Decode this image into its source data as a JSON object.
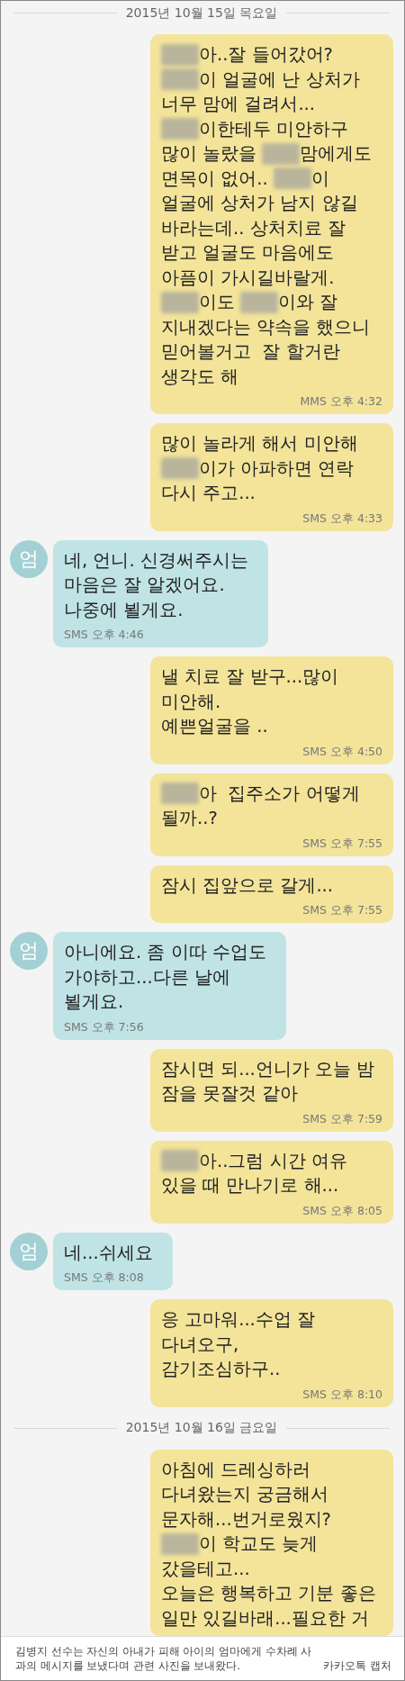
{
  "conversation": [
    {
      "kind": "date",
      "text": "2015년 10월 15일 목요일"
    },
    {
      "kind": "sent",
      "meta": "MMS 오후 4:32",
      "lines": [
        [
          {
            "kind": "redacted"
          },
          {
            "kind": "text",
            "text": "아..잘 들어갔어?"
          }
        ],
        [
          {
            "kind": "redacted"
          },
          {
            "kind": "text",
            "text": "이 얼굴에 난 상처가"
          }
        ],
        [
          {
            "kind": "text",
            "text": "너무 맘에 걸려서..."
          }
        ],
        [
          {
            "kind": "redacted"
          },
          {
            "kind": "text",
            "text": "이한테두 미안하구"
          }
        ],
        [
          {
            "kind": "text",
            "text": "많이 놀랐을 "
          },
          {
            "kind": "redacted"
          },
          {
            "kind": "text",
            "text": "맘에게도"
          }
        ],
        [
          {
            "kind": "text",
            "text": "면목이 없어.. "
          },
          {
            "kind": "redacted"
          },
          {
            "kind": "text",
            "text": "이"
          }
        ],
        [
          {
            "kind": "text",
            "text": "얼굴에 상처가 남지 않길"
          }
        ],
        [
          {
            "kind": "text",
            "text": "바라는데.. 상처치료 잘"
          }
        ],
        [
          {
            "kind": "text",
            "text": "받고 얼굴도 마음에도"
          }
        ],
        [
          {
            "kind": "text",
            "text": "아픔이 가시길바랄게."
          }
        ],
        [
          {
            "kind": "redacted"
          },
          {
            "kind": "text",
            "text": "이도 "
          },
          {
            "kind": "redacted"
          },
          {
            "kind": "text",
            "text": "이와 잘"
          }
        ],
        [
          {
            "kind": "text",
            "text": "지내겠다는 약속을 했으니"
          }
        ],
        [
          {
            "kind": "text",
            "text": "믿어볼거고  잘 할거란"
          }
        ],
        [
          {
            "kind": "text",
            "text": "생각도 해"
          }
        ]
      ]
    },
    {
      "kind": "sent",
      "meta": "SMS 오후 4:33",
      "lines": [
        [
          {
            "kind": "text",
            "text": "많이 놀라게 해서 미안해"
          }
        ],
        [
          {
            "kind": "redacted"
          },
          {
            "kind": "text",
            "text": "이가 아파하면 연락"
          }
        ],
        [
          {
            "kind": "text",
            "text": "다시 주고..."
          }
        ]
      ]
    },
    {
      "kind": "received",
      "avatar": "엄",
      "meta": "SMS 오후 4:46",
      "lines": [
        [
          {
            "kind": "text",
            "text": "네, 언니. 신경써주시는"
          }
        ],
        [
          {
            "kind": "text",
            "text": "마음은 잘 알겠어요."
          }
        ],
        [
          {
            "kind": "text",
            "text": "나중에 뵐게요."
          }
        ]
      ]
    },
    {
      "kind": "sent",
      "meta": "SMS 오후 4:50",
      "lines": [
        [
          {
            "kind": "text",
            "text": "낼 치료 잘 받구...많이"
          }
        ],
        [
          {
            "kind": "text",
            "text": "미안해."
          }
        ],
        [
          {
            "kind": "text",
            "text": "예쁜얼굴을 .."
          }
        ]
      ]
    },
    {
      "kind": "sent",
      "meta": "SMS 오후 7:55",
      "lines": [
        [
          {
            "kind": "redacted"
          },
          {
            "kind": "text",
            "text": "아  집주소가 어떻게"
          }
        ],
        [
          {
            "kind": "text",
            "text": "될까..?"
          }
        ]
      ]
    },
    {
      "kind": "sent",
      "meta": "SMS 오후 7:55",
      "lines": [
        [
          {
            "kind": "text",
            "text": "잠시 집앞으로 갈게..."
          }
        ]
      ]
    },
    {
      "kind": "received",
      "avatar": "엄",
      "meta": "SMS 오후 7:56",
      "lines": [
        [
          {
            "kind": "text",
            "text": "아니에요. 좀 이따 수업도"
          }
        ],
        [
          {
            "kind": "text",
            "text": "가야하고...다른 날에"
          }
        ],
        [
          {
            "kind": "text",
            "text": "뵐게요."
          }
        ]
      ]
    },
    {
      "kind": "sent",
      "meta": "SMS 오후 7:59",
      "lines": [
        [
          {
            "kind": "text",
            "text": "잠시면 되...언니가 오늘 밤"
          }
        ],
        [
          {
            "kind": "text",
            "text": "잠을 못잘것 같아"
          }
        ]
      ]
    },
    {
      "kind": "sent",
      "meta": "SMS 오후 8:05",
      "lines": [
        [
          {
            "kind": "redacted"
          },
          {
            "kind": "text",
            "text": "아..그럼 시간 여유"
          }
        ],
        [
          {
            "kind": "text",
            "text": "있을 때 만나기로 해..."
          }
        ]
      ]
    },
    {
      "kind": "received",
      "avatar": "엄",
      "meta": "SMS 오후 8:08",
      "lines": [
        [
          {
            "kind": "text",
            "text": "네...쉬세요"
          }
        ]
      ]
    },
    {
      "kind": "sent",
      "meta": "SMS 오후 8:10",
      "lines": [
        [
          {
            "kind": "text",
            "text": "응 고마워...수업 잘"
          }
        ],
        [
          {
            "kind": "text",
            "text": "다녀오구,"
          }
        ],
        [
          {
            "kind": "text",
            "text": "감기조심하구.."
          }
        ]
      ]
    },
    {
      "kind": "date",
      "text": "2015년 10월 16일 금요일"
    },
    {
      "kind": "sent",
      "lines": [
        [
          {
            "kind": "text",
            "text": "아침에 드레싱하러"
          }
        ],
        [
          {
            "kind": "text",
            "text": "다녀왔는지 궁금해서"
          }
        ],
        [
          {
            "kind": "text",
            "text": "문자해...번거로웠지?"
          }
        ],
        [
          {
            "kind": "redacted"
          },
          {
            "kind": "text",
            "text": "이 학교도 늦게"
          }
        ],
        [
          {
            "kind": "text",
            "text": "갔을테고..."
          }
        ],
        [
          {
            "kind": "text",
            "text": "오늘은 행복하고 기분 좋은"
          }
        ],
        [
          {
            "kind": "text",
            "text": "일만 있길바래...필요한 거"
          }
        ]
      ]
    }
  ],
  "caption": {
    "text": "김병지 선수는 자신의 아내가 피해 아이의 엄마에게 수차례 사과의 메시지를 보냈다며 관련 사진을 보내왔다.",
    "credit": "카카오톡 캡처"
  }
}
